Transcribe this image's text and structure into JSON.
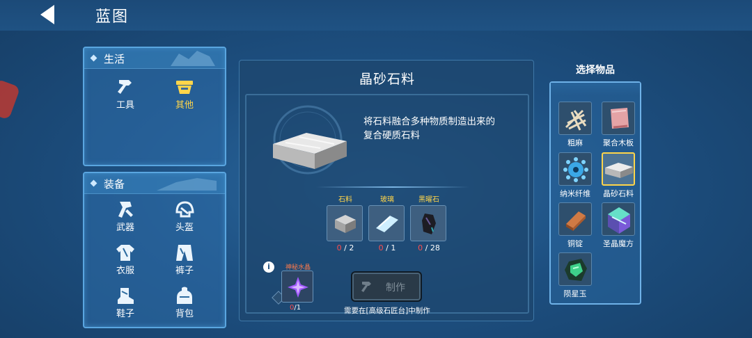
{
  "header": {
    "title": "蓝图",
    "back": "back-arrow-icon"
  },
  "life": {
    "title": "生活",
    "items": [
      {
        "label": "工具",
        "icon": "hammer-icon",
        "active": false
      },
      {
        "label": "其他",
        "icon": "basket-icon",
        "active": true
      }
    ]
  },
  "equip": {
    "title": "装备",
    "items": [
      {
        "label": "武器",
        "icon": "sword-icon"
      },
      {
        "label": "头盔",
        "icon": "helmet-icon"
      },
      {
        "label": "衣服",
        "icon": "shirt-icon"
      },
      {
        "label": "裤子",
        "icon": "pants-icon"
      },
      {
        "label": "鞋子",
        "icon": "boot-icon"
      },
      {
        "label": "背包",
        "icon": "backpack-icon"
      }
    ]
  },
  "detail": {
    "title": "晶砂石料",
    "desc": "将石料融合多种物质制造出来的复合硬质石料",
    "materials": [
      {
        "name": "石料",
        "have": "0",
        "need": "/ 2"
      },
      {
        "name": "玻璃",
        "have": "0",
        "need": "/ 1"
      },
      {
        "name": "黑曜石",
        "have": "0",
        "need": "/ 28"
      }
    ],
    "crystal": {
      "name": "神秘水晶",
      "have": "0",
      "need": "/1"
    },
    "craft_label": "制作",
    "note": "需要在[高级石匠台]中制作",
    "accent": "#ffd54a",
    "warn": "#ff4d4d"
  },
  "select": {
    "title": "选择物品",
    "items": [
      {
        "label": "粗麻"
      },
      {
        "label": "聚合木板"
      },
      {
        "label": "纳米纤维"
      },
      {
        "label": "晶砂石料",
        "selected": true
      },
      {
        "label": "铜锭"
      },
      {
        "label": "圣晶魔方"
      },
      {
        "label": "陨星玉"
      }
    ]
  }
}
